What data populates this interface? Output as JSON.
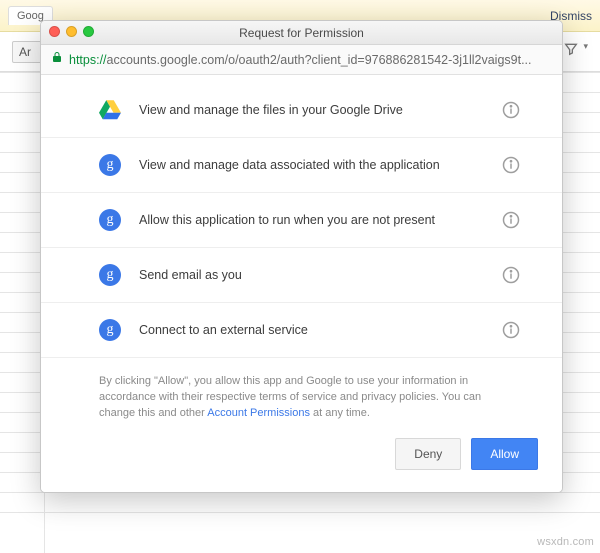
{
  "background": {
    "tab_label": "Goog",
    "dismiss": "Dismiss",
    "font_select": "Ar"
  },
  "modal": {
    "title": "Request for Permission",
    "url": {
      "scheme": "https://",
      "host_path": "accounts.google.com/o/oauth2/auth?client_id=976886281542-3j1ll2vaigs9t..."
    },
    "permissions": [
      {
        "icon": "drive",
        "text": "View and manage the files in your Google Drive"
      },
      {
        "icon": "g",
        "text": "View and manage data associated with the application"
      },
      {
        "icon": "g",
        "text": "Allow this application to run when you are not present"
      },
      {
        "icon": "g",
        "text": "Send email as you"
      },
      {
        "icon": "g",
        "text": "Connect to an external service"
      }
    ],
    "disclosure": {
      "pre": "By clicking \"Allow\", you allow this app and Google to use your information in accordance with their respective terms of service and privacy policies. You can change this and other ",
      "link": "Account Permissions",
      "post": " at any time."
    },
    "buttons": {
      "deny": "Deny",
      "allow": "Allow"
    }
  },
  "watermark": "wsxdn.com",
  "colors": {
    "primary": "#4285f4"
  }
}
